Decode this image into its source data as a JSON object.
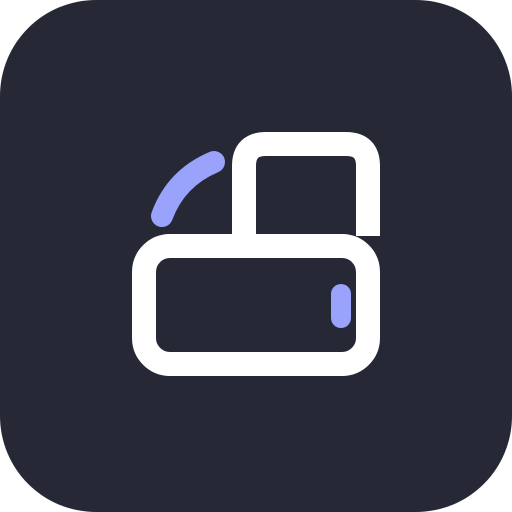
{
  "icon": {
    "name": "app-icon",
    "glyph": "storage-lock-icon",
    "colors": {
      "background": "#272835",
      "outline": "#ffffff",
      "accent": "#99a3fb"
    }
  }
}
